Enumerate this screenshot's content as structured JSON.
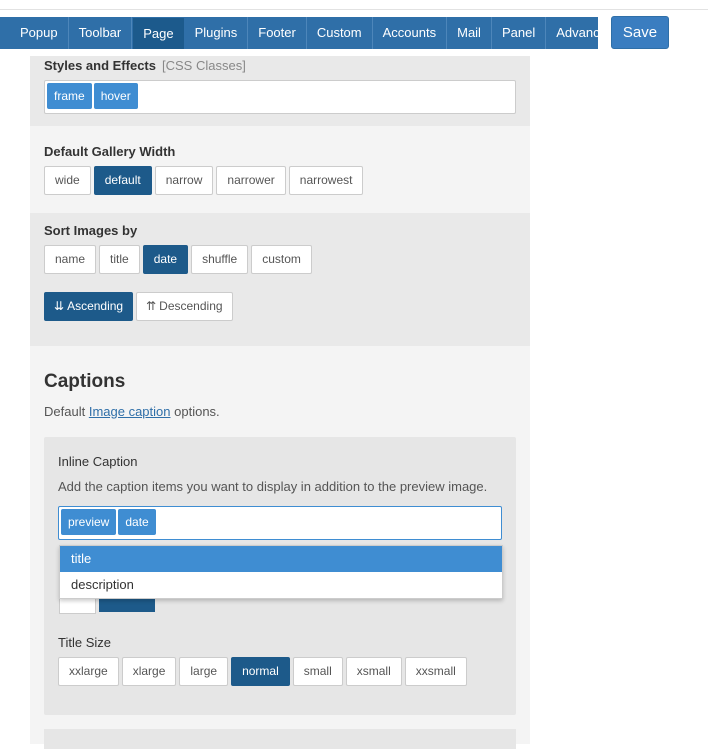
{
  "nav": {
    "tabs": [
      "Popup",
      "Toolbar",
      "Page",
      "Plugins",
      "Footer",
      "Custom",
      "Accounts",
      "Mail",
      "Panel",
      "Advanced"
    ],
    "active": "Page",
    "save_label": "Save"
  },
  "styles_effects": {
    "label": "Styles and Effects",
    "hint": "[CSS Classes]",
    "tags": [
      "frame",
      "hover"
    ]
  },
  "gallery_width": {
    "label": "Default Gallery Width",
    "options": [
      "wide",
      "default",
      "narrow",
      "narrower",
      "narrowest"
    ],
    "selected": "default"
  },
  "sort_images": {
    "label": "Sort Images by",
    "options": [
      "name",
      "title",
      "date",
      "shuffle",
      "custom"
    ],
    "selected": "date",
    "order_options": [
      "Ascending",
      "Descending"
    ],
    "order_selected": "Ascending"
  },
  "captions": {
    "heading": "Captions",
    "desc_prefix": "Default",
    "desc_link": "Image caption",
    "desc_suffix": "options.",
    "inline_caption": {
      "label": "Inline Caption",
      "desc": "Add the caption items you want to display in addition to the preview image.",
      "tags": [
        "preview",
        "date"
      ],
      "dropdown_items": [
        "title",
        "description"
      ],
      "highlighted": "title"
    },
    "title_size": {
      "label": "Title Size",
      "options": [
        "xxlarge",
        "xlarge",
        "large",
        "normal",
        "small",
        "xsmall",
        "xxsmall"
      ],
      "selected": "normal"
    }
  },
  "colors": {
    "nav_bg": "#2f6fa8",
    "selected_btn": "#1d5a8a",
    "tag_bg": "#3f8dd2"
  }
}
